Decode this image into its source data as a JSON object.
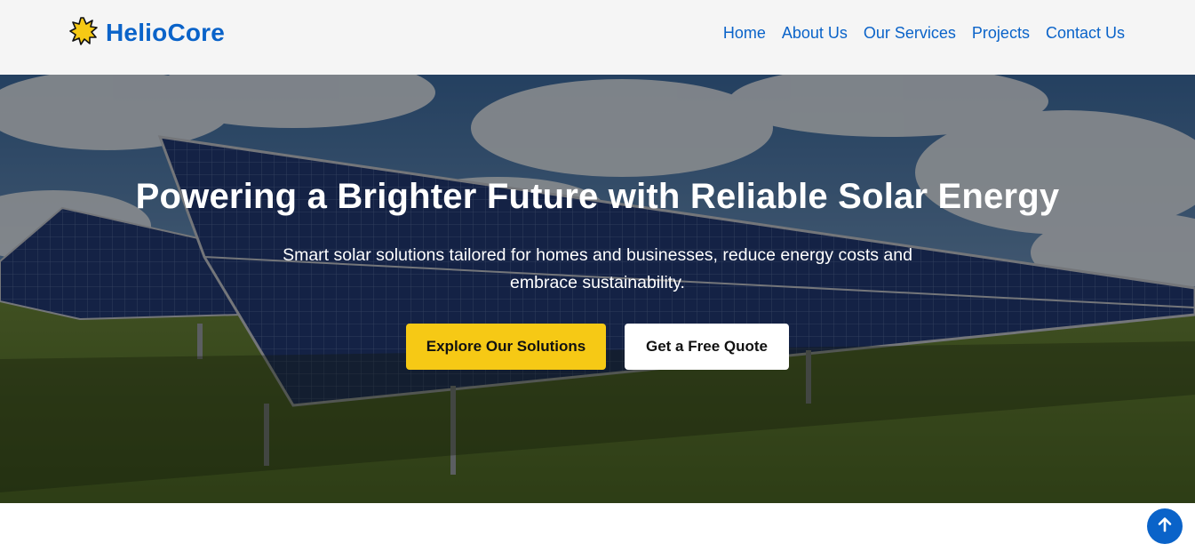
{
  "brand": {
    "name": "HelioCore",
    "logo_icon": "sun-icon",
    "logo_color": "#f6c915"
  },
  "nav": {
    "items": [
      {
        "label": "Home"
      },
      {
        "label": "About Us"
      },
      {
        "label": "Our Services"
      },
      {
        "label": "Projects"
      },
      {
        "label": "Contact Us"
      }
    ]
  },
  "hero": {
    "title": "Powering a Brighter Future with Reliable Solar Energy",
    "subtitle": "Smart solar solutions tailored for homes and businesses, reduce energy costs and embrace sustainability.",
    "primary_button": "Explore Our Solutions",
    "secondary_button": "Get a Free Quote",
    "background_image": "solar-panels-field"
  },
  "scroll_top": {
    "icon": "arrow-up-icon"
  },
  "colors": {
    "brand_blue": "#0a63c9",
    "accent_yellow": "#f6c915",
    "header_bg": "#f5f5f5"
  }
}
